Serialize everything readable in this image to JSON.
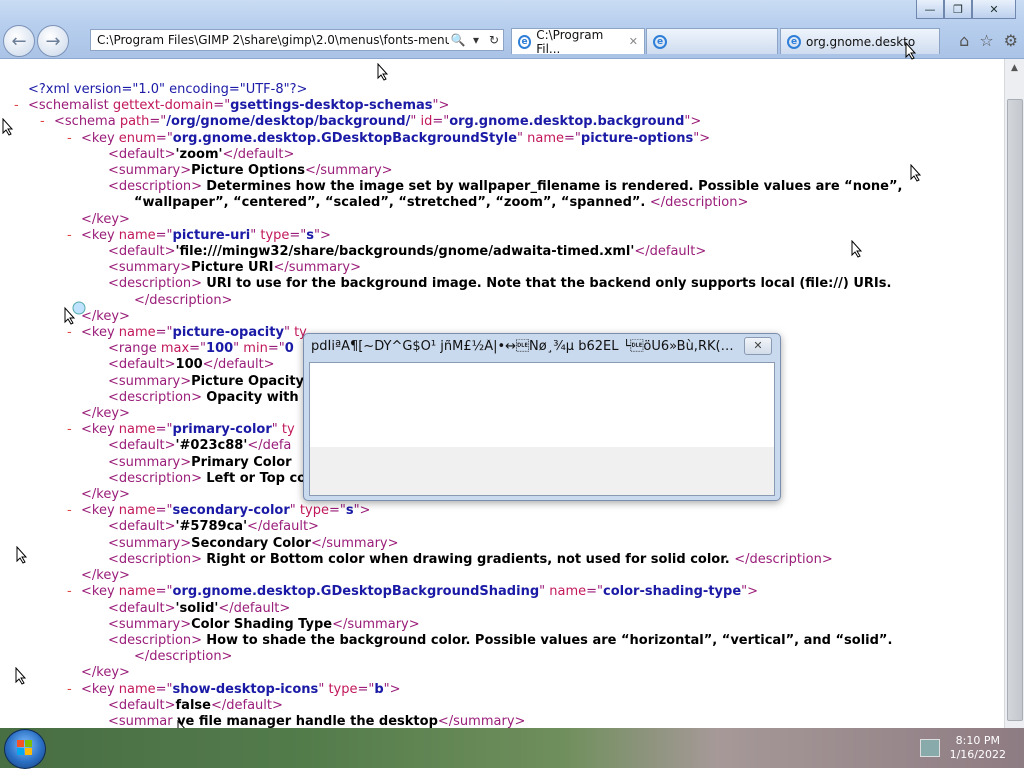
{
  "window": {
    "minimize_label": "—",
    "maximize_label": "❐",
    "close_label": "✕"
  },
  "address": {
    "url": "C:\\Program Files\\GIMP 2\\share\\gimp\\2.0\\menus\\fonts-menu.xml",
    "search_icon": "🔍",
    "dropdown_icon": "▾",
    "refresh_icon": "↻"
  },
  "tabs": [
    {
      "label": "C:\\Program Fil...",
      "close": "✕"
    },
    {
      "label": ""
    },
    {
      "label": "org.gnome.deskto"
    }
  ],
  "toolbar": {
    "home": "⌂",
    "favorites": "☆",
    "settings": "⚙"
  },
  "xml_lines": [
    {
      "marker": "",
      "indent": 28,
      "parts": [
        [
          "pi",
          "<?xml version=\"1.0\" encoding=\"UTF-8\"?>"
        ]
      ]
    },
    {
      "marker": "-",
      "indent": 28,
      "parts": [
        [
          "t",
          "<schemalist "
        ],
        [
          "an",
          "gettext-domain"
        ],
        [
          "t",
          "=\""
        ],
        [
          "av",
          "gsettings-desktop-schemas"
        ],
        [
          "t",
          "\">"
        ]
      ]
    },
    {
      "marker": "-",
      "indent": 54,
      "parts": [
        [
          "t",
          "<schema "
        ],
        [
          "an",
          "path"
        ],
        [
          "t",
          "=\""
        ],
        [
          "av",
          "/org/gnome/desktop/background/"
        ],
        [
          "t",
          "\" "
        ],
        [
          "an",
          "id"
        ],
        [
          "t",
          "=\""
        ],
        [
          "av",
          "org.gnome.desktop.background"
        ],
        [
          "t",
          "\">"
        ]
      ]
    },
    {
      "marker": "-",
      "indent": 81,
      "parts": [
        [
          "t",
          "<key "
        ],
        [
          "an",
          "enum"
        ],
        [
          "t",
          "=\""
        ],
        [
          "av",
          "org.gnome.desktop.GDesktopBackgroundStyle"
        ],
        [
          "t",
          "\" "
        ],
        [
          "an",
          "name"
        ],
        [
          "t",
          "=\""
        ],
        [
          "av",
          "picture-options"
        ],
        [
          "t",
          "\">"
        ]
      ]
    },
    {
      "marker": "",
      "indent": 108,
      "parts": [
        [
          "t",
          "<default>"
        ],
        [
          "tx",
          "'zoom'"
        ],
        [
          "t",
          "</default>"
        ]
      ]
    },
    {
      "marker": "",
      "indent": 108,
      "parts": [
        [
          "t",
          "<summary>"
        ],
        [
          "tx",
          "Picture Options"
        ],
        [
          "t",
          "</summary>"
        ]
      ]
    },
    {
      "marker": "",
      "indent": 108,
      "parts": [
        [
          "t",
          "<description> "
        ],
        [
          "tx",
          "Determines how the image set by wallpaper_filename is rendered. Possible values are “none”,"
        ]
      ]
    },
    {
      "marker": "",
      "indent": 134,
      "parts": [
        [
          "tx",
          "“wallpaper”, “centered”, “scaled”, “stretched”, “zoom”, “spanned”. "
        ],
        [
          "t",
          "</description>"
        ]
      ]
    },
    {
      "marker": "",
      "indent": 81,
      "parts": [
        [
          "t",
          "</key>"
        ]
      ]
    },
    {
      "marker": "-",
      "indent": 81,
      "parts": [
        [
          "t",
          "<key "
        ],
        [
          "an",
          "name"
        ],
        [
          "t",
          "=\""
        ],
        [
          "av",
          "picture-uri"
        ],
        [
          "t",
          "\" "
        ],
        [
          "an",
          "type"
        ],
        [
          "t",
          "=\""
        ],
        [
          "av",
          "s"
        ],
        [
          "t",
          "\">"
        ]
      ]
    },
    {
      "marker": "",
      "indent": 108,
      "parts": [
        [
          "t",
          "<default>"
        ],
        [
          "tx",
          "'file:///mingw32/share/backgrounds/gnome/adwaita-timed.xml'"
        ],
        [
          "t",
          "</default>"
        ]
      ]
    },
    {
      "marker": "",
      "indent": 108,
      "parts": [
        [
          "t",
          "<summary>"
        ],
        [
          "tx",
          "Picture URI"
        ],
        [
          "t",
          "</summary>"
        ]
      ]
    },
    {
      "marker": "",
      "indent": 108,
      "parts": [
        [
          "t",
          "<description> "
        ],
        [
          "tx",
          "URI to use for the background image. Note that the backend only supports local (file://) URIs."
        ]
      ]
    },
    {
      "marker": "",
      "indent": 134,
      "parts": [
        [
          "t",
          "</description>"
        ]
      ]
    },
    {
      "marker": "",
      "indent": 81,
      "parts": [
        [
          "t",
          "</key>"
        ]
      ]
    },
    {
      "marker": "-",
      "indent": 81,
      "parts": [
        [
          "t",
          "<key "
        ],
        [
          "an",
          "name"
        ],
        [
          "t",
          "=\""
        ],
        [
          "av",
          "picture-opacity"
        ],
        [
          "t",
          "\" "
        ],
        [
          "an",
          "ty"
        ]
      ]
    },
    {
      "marker": "",
      "indent": 108,
      "parts": [
        [
          "t",
          "<range "
        ],
        [
          "an",
          "max"
        ],
        [
          "t",
          "=\""
        ],
        [
          "av",
          "100"
        ],
        [
          "t",
          "\" "
        ],
        [
          "an",
          "min"
        ],
        [
          "t",
          "=\""
        ],
        [
          "av",
          "0"
        ]
      ]
    },
    {
      "marker": "",
      "indent": 108,
      "parts": [
        [
          "t",
          "<default>"
        ],
        [
          "tx",
          "100"
        ],
        [
          "t",
          "</default>"
        ]
      ]
    },
    {
      "marker": "",
      "indent": 108,
      "parts": [
        [
          "t",
          "<summary>"
        ],
        [
          "tx",
          "Picture Opacity"
        ]
      ]
    },
    {
      "marker": "",
      "indent": 108,
      "parts": [
        [
          "t",
          "<description> "
        ],
        [
          "tx",
          "Opacity with"
        ]
      ]
    },
    {
      "marker": "",
      "indent": 81,
      "parts": [
        [
          "t",
          "</key>"
        ]
      ]
    },
    {
      "marker": "-",
      "indent": 81,
      "parts": [
        [
          "t",
          "<key "
        ],
        [
          "an",
          "name"
        ],
        [
          "t",
          "=\""
        ],
        [
          "av",
          "primary-color"
        ],
        [
          "t",
          "\" "
        ],
        [
          "an",
          "ty"
        ]
      ]
    },
    {
      "marker": "",
      "indent": 108,
      "parts": [
        [
          "t",
          "<default>"
        ],
        [
          "tx",
          "'#023c88'"
        ],
        [
          "t",
          "</defa"
        ]
      ]
    },
    {
      "marker": "",
      "indent": 108,
      "parts": [
        [
          "t",
          "<summary>"
        ],
        [
          "tx",
          "Primary Color"
        ]
      ]
    },
    {
      "marker": "",
      "indent": 108,
      "parts": [
        [
          "t",
          "<description> "
        ],
        [
          "tx",
          "Left or Top co"
        ]
      ]
    },
    {
      "marker": "",
      "indent": 81,
      "parts": [
        [
          "t",
          "</key>"
        ]
      ]
    },
    {
      "marker": "-",
      "indent": 81,
      "parts": [
        [
          "t",
          "<key "
        ],
        [
          "an",
          "name"
        ],
        [
          "t",
          "=\""
        ],
        [
          "av",
          "secondary-color"
        ],
        [
          "t",
          "\" "
        ],
        [
          "an",
          "type"
        ],
        [
          "t",
          "=\""
        ],
        [
          "av",
          "s"
        ],
        [
          "t",
          "\">"
        ]
      ]
    },
    {
      "marker": "",
      "indent": 108,
      "parts": [
        [
          "t",
          "<default>"
        ],
        [
          "tx",
          "'#5789ca'"
        ],
        [
          "t",
          "</default>"
        ]
      ]
    },
    {
      "marker": "",
      "indent": 108,
      "parts": [
        [
          "t",
          "<summary>"
        ],
        [
          "tx",
          "Secondary Color"
        ],
        [
          "t",
          "</summary>"
        ]
      ]
    },
    {
      "marker": "",
      "indent": 108,
      "parts": [
        [
          "t",
          "<description> "
        ],
        [
          "tx",
          "Right or Bottom color when drawing gradients, not used for solid color. "
        ],
        [
          "t",
          "</description>"
        ]
      ]
    },
    {
      "marker": "",
      "indent": 81,
      "parts": [
        [
          "t",
          "</key>"
        ]
      ]
    },
    {
      "marker": "-",
      "indent": 81,
      "parts": [
        [
          "t",
          "<key "
        ],
        [
          "an",
          "name"
        ],
        [
          "t",
          "=\""
        ],
        [
          "av",
          "org.gnome.desktop.GDesktopBackgroundShading"
        ],
        [
          "t",
          "\" "
        ],
        [
          "an",
          "name"
        ],
        [
          "t",
          "=\""
        ],
        [
          "av",
          "color-shading-type"
        ],
        [
          "t",
          "\">"
        ]
      ]
    },
    {
      "marker": "",
      "indent": 108,
      "parts": [
        [
          "t",
          "<default>"
        ],
        [
          "tx",
          "'solid'"
        ],
        [
          "t",
          "</default>"
        ]
      ]
    },
    {
      "marker": "",
      "indent": 108,
      "parts": [
        [
          "t",
          "<summary>"
        ],
        [
          "tx",
          "Color Shading Type"
        ],
        [
          "t",
          "</summary>"
        ]
      ]
    },
    {
      "marker": "",
      "indent": 108,
      "parts": [
        [
          "t",
          "<description> "
        ],
        [
          "tx",
          "How to shade the background color. Possible values are “horizontal”, “vertical”, and “solid”."
        ]
      ]
    },
    {
      "marker": "",
      "indent": 134,
      "parts": [
        [
          "t",
          "</description>"
        ]
      ]
    },
    {
      "marker": "",
      "indent": 81,
      "parts": [
        [
          "t",
          "</key>"
        ]
      ]
    },
    {
      "marker": "-",
      "indent": 81,
      "parts": [
        [
          "t",
          "<key "
        ],
        [
          "an",
          "name"
        ],
        [
          "t",
          "=\""
        ],
        [
          "av",
          "show-desktop-icons"
        ],
        [
          "t",
          "\" "
        ],
        [
          "an",
          "type"
        ],
        [
          "t",
          "=\""
        ],
        [
          "av",
          "b"
        ],
        [
          "t",
          "\">"
        ]
      ]
    },
    {
      "marker": "",
      "indent": 108,
      "parts": [
        [
          "t",
          "<default>"
        ],
        [
          "tx",
          "false"
        ],
        [
          "t",
          "</default>"
        ]
      ]
    },
    {
      "marker": "",
      "indent": 108,
      "parts": [
        [
          "t",
          "<summar"
        ],
        [
          "tx",
          "   ve file manager handle the desktop"
        ],
        [
          "t",
          "</summary>"
        ]
      ]
    }
  ],
  "dialog": {
    "title": "pdÌiªÃ¶[~DY^G$Ô¹ jñM£½Â|•↔\u0010Nø¸¾µ b62EL └\u0010öÙ6»Bù,RK(♂└…",
    "close_label": "✕"
  },
  "taskbar": {
    "time": "8:10 PM",
    "date": "1/16/2022"
  }
}
